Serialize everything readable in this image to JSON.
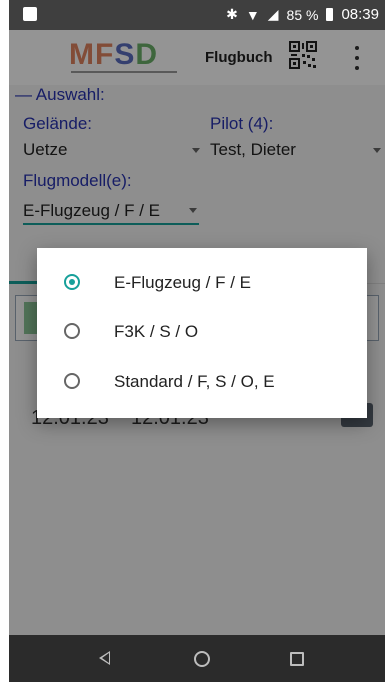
{
  "status_bar": {
    "battery_percent": "85 %",
    "time": "08:39"
  },
  "app_bar": {
    "logo_text": "MFSD",
    "title": "Flugbuch",
    "menu_icon": "overflow-menu-icon",
    "qr_icon": "qr-code-icon"
  },
  "form": {
    "section_label": "— Auswahl:",
    "site_label": "Gelände:",
    "site_value": "Uetze",
    "pilot_label": "Pilot (4):",
    "pilot_value": "Test, Dieter",
    "model_label": "Flugmodell(e):",
    "model_value": "E-Flugzeug / F / E"
  },
  "background": {
    "dates": [
      "12.01.23",
      "12.01.23"
    ]
  },
  "dialog": {
    "options": [
      {
        "label": "E-Flugzeug / F / E",
        "selected": true
      },
      {
        "label": "F3K / S / O",
        "selected": false
      },
      {
        "label": "Standard / F, S / O, E",
        "selected": false
      }
    ]
  },
  "colors": {
    "accent": "#17a09a",
    "label_blue": "#2833b0",
    "status_bar": "#3f3f3f",
    "nav_bar": "#2b2b2b"
  }
}
